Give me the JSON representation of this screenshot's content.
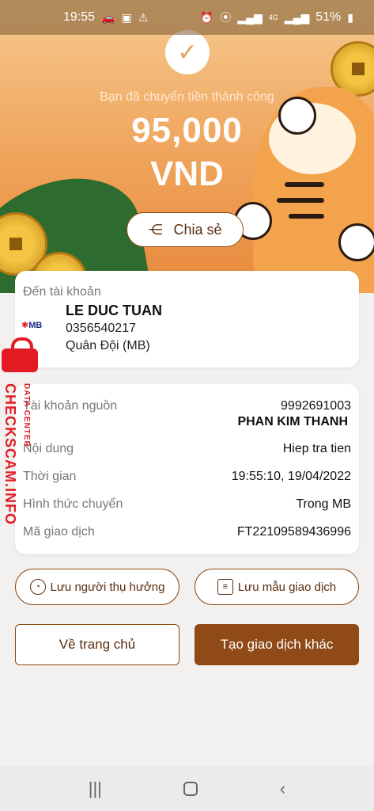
{
  "status_bar": {
    "time": "19:55",
    "battery": "51%",
    "network": "4G"
  },
  "hero": {
    "success_message": "Bạn đã chuyển tiền thành công",
    "amount": "95,000",
    "currency": "VND",
    "share_label": "Chia sẻ"
  },
  "recipient": {
    "label": "Đến tài khoản",
    "bank_logo": "MB",
    "name": "LE DUC TUAN",
    "account": "0356540217",
    "bank": "Quân Đội (MB)"
  },
  "details": {
    "source_label": "Tài khoản nguồn",
    "source_account": "9992691003",
    "source_name": "PHAN KIM THANH",
    "content_label": "Nội dung",
    "content_value": "Hiep tra tien",
    "time_label": "Thời gian",
    "time_value": "19:55:10, 19/04/2022",
    "method_label": "Hình thức chuyển",
    "method_value": "Trong MB",
    "txn_label": "Mã giao dịch",
    "txn_value": "FT22109589436996"
  },
  "actions": {
    "save_beneficiary": "Lưu người thụ hưởng",
    "save_template": "Lưu mẫu giao dịch",
    "home": "Về trang chủ",
    "new_transaction": "Tạo giao dịch khác"
  },
  "watermark": {
    "text": "CHECKSCAM.INFO",
    "subtext": "DATA CENTER"
  },
  "colors": {
    "accent": "#8f4a17",
    "hero_top": "#f6c98f",
    "hero_bottom": "#e8893c"
  }
}
